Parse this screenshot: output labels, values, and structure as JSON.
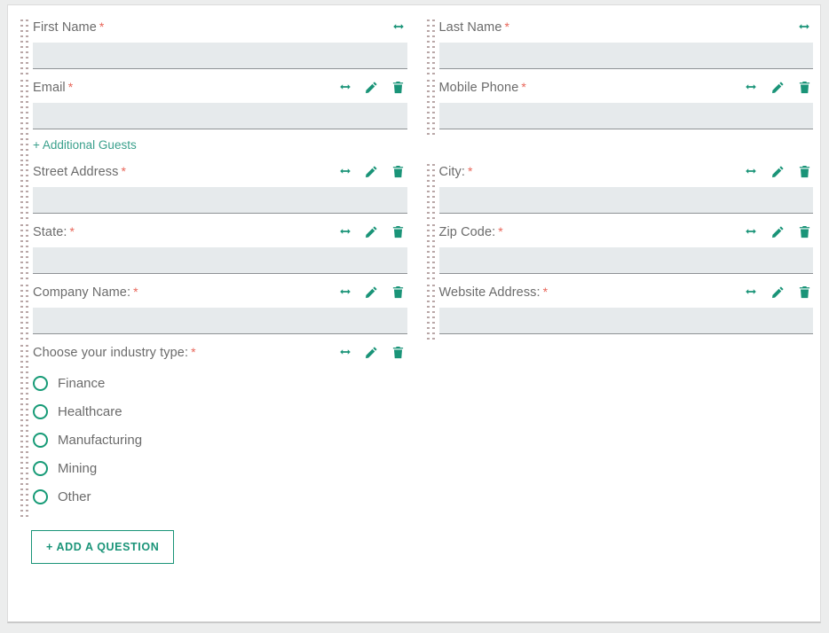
{
  "colors": {
    "accent": "#1a9478",
    "link": "#3aa08c",
    "required": "#e8665a",
    "label": "#6b6b6b",
    "input_bg": "#e6eaec",
    "page_bg": "#eceded",
    "card_bg": "#ffffff",
    "radio_ring": "#179b77"
  },
  "icons": {
    "drag": "drag-handle-dots-icon",
    "resize": "resize-horizontal-icon",
    "edit": "pencil-edit-icon",
    "delete": "trash-delete-icon"
  },
  "form": {
    "rows": [
      {
        "left": {
          "label": "First Name",
          "required": "*",
          "tools": [
            "resize"
          ],
          "type": "text",
          "value": "",
          "placeholder": ""
        },
        "right": {
          "label": "Last Name",
          "required": "*",
          "tools": [
            "resize"
          ],
          "type": "text",
          "value": "",
          "placeholder": ""
        }
      },
      {
        "left": {
          "label": "Email",
          "required": "*",
          "tools": [
            "resize",
            "edit",
            "delete"
          ],
          "type": "text",
          "value": "",
          "placeholder": "",
          "extra_link": "+ Additional Guests"
        },
        "right": {
          "label": "Mobile Phone",
          "required": "*",
          "tools": [
            "resize",
            "edit",
            "delete"
          ],
          "type": "text",
          "value": "",
          "placeholder": ""
        }
      },
      {
        "left": {
          "label": "Street Address",
          "required": "*",
          "tools": [
            "resize",
            "edit",
            "delete"
          ],
          "type": "text",
          "value": "",
          "placeholder": ""
        },
        "right": {
          "label": "City:",
          "required": "*",
          "tools": [
            "resize",
            "edit",
            "delete"
          ],
          "type": "text",
          "value": "",
          "placeholder": ""
        }
      },
      {
        "left": {
          "label": "State:",
          "required": "*",
          "tools": [
            "resize",
            "edit",
            "delete"
          ],
          "type": "text",
          "value": "",
          "placeholder": ""
        },
        "right": {
          "label": "Zip Code:",
          "required": "*",
          "tools": [
            "resize",
            "edit",
            "delete"
          ],
          "type": "text",
          "value": "",
          "placeholder": ""
        }
      },
      {
        "left": {
          "label": "Company Name:",
          "required": "*",
          "tools": [
            "resize",
            "edit",
            "delete"
          ],
          "type": "text",
          "value": "",
          "placeholder": ""
        },
        "right": {
          "label": "Website Address:",
          "required": "*",
          "tools": [
            "resize",
            "edit",
            "delete"
          ],
          "type": "text",
          "value": "",
          "placeholder": ""
        }
      }
    ],
    "industry_question": {
      "label": "Choose your industry type:",
      "required": "*",
      "tools": [
        "resize",
        "edit",
        "delete"
      ],
      "type": "radio",
      "selected": "",
      "options": [
        "Finance",
        "Healthcare",
        "Manufacturing",
        "Mining",
        "Other"
      ]
    },
    "add_question_button": "+ ADD A QUESTION"
  }
}
